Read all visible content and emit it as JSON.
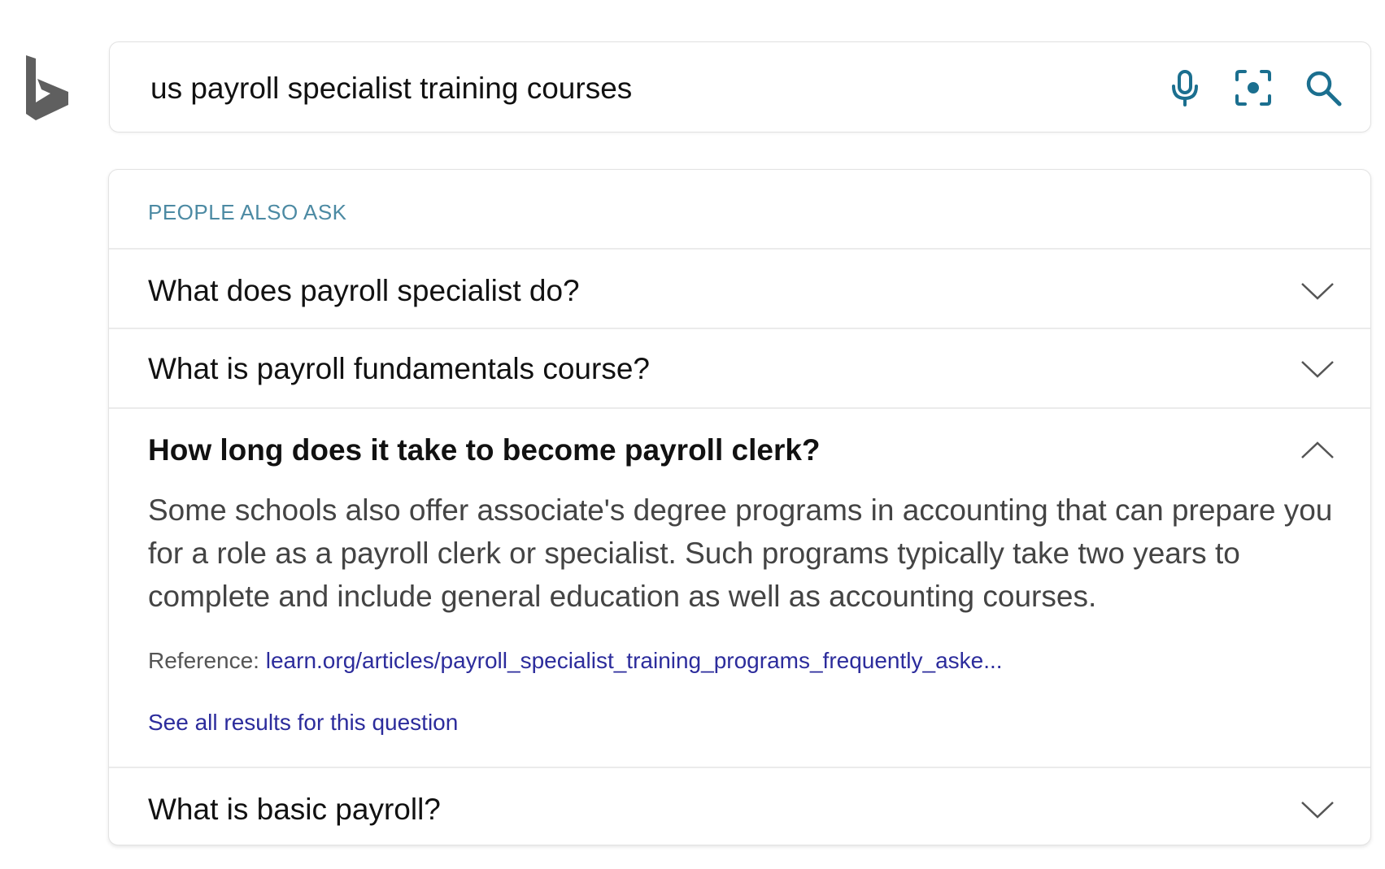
{
  "search": {
    "query": "us payroll specialist training courses",
    "icons": [
      "microphone-icon",
      "visual-search-icon",
      "search-icon"
    ]
  },
  "people_also_ask": {
    "header": "PEOPLE ALSO ASK",
    "questions": [
      {
        "text": "What does payroll specialist do?",
        "expanded": false
      },
      {
        "text": "What is payroll fundamentals course?",
        "expanded": false
      },
      {
        "text": "How long does it take to become payroll clerk?",
        "expanded": true,
        "answer": "Some schools also offer associate's degree programs in accounting that can prepare you for a role as a payroll clerk or specialist. Such programs typically take two years to complete and include general education as well as accounting courses.",
        "reference_label": "Reference: ",
        "reference_link": "learn.org/articles/payroll_specialist_training_programs_frequently_aske...",
        "see_all": "See all results for this question"
      },
      {
        "text": "What is basic payroll?",
        "expanded": false
      }
    ]
  },
  "colors": {
    "header_accent": "#4c8aa3",
    "icon_accent": "#1b6f8f",
    "link": "#2c2c9c"
  }
}
